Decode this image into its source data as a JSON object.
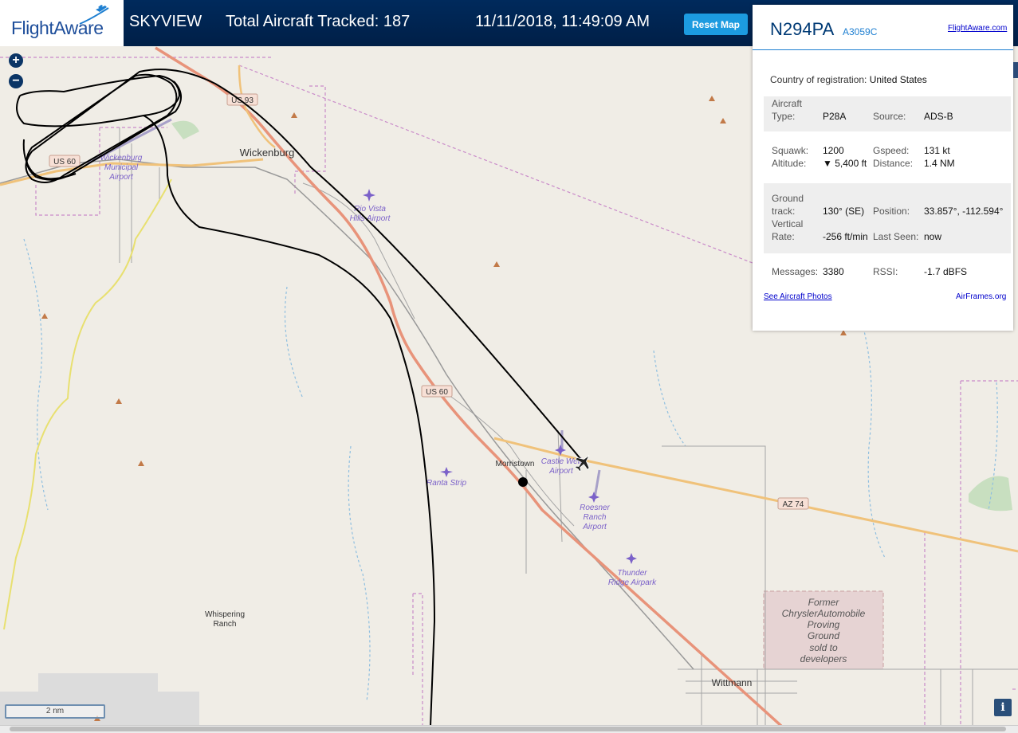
{
  "header": {
    "brand": "FlightAware",
    "app_name": "SKYVIEW",
    "total_tracked": "Total Aircraft Tracked: 187",
    "datetime": "11/11/2018, 11:49:09 AM",
    "reset_label": "Reset Map"
  },
  "map": {
    "zoom_in": "+",
    "zoom_out": "−",
    "scale_label": "2 nm",
    "info_label": "i",
    "labels": {
      "us93": "US 93",
      "us60_west": "US 60",
      "us60_mid": "US 60",
      "az74": "AZ 74",
      "wickenburg": "Wickenburg",
      "wick_airport": [
        "Wickenburg",
        "Municipal",
        "Airport"
      ],
      "rio_vista": [
        "Rio Vista",
        "Hills Airport"
      ],
      "castle_well": [
        "Castle Well",
        "Airport"
      ],
      "morristown": "Morristown",
      "ranta": "Ranta Strip",
      "roesner": [
        "Roesner",
        "Ranch",
        "Airport"
      ],
      "thunder": [
        "Thunder",
        "Ridge Airpark"
      ],
      "whispering": [
        "Whispering",
        "Ranch"
      ],
      "former": [
        "Former",
        "ChryslerAutomobile",
        "Proving",
        "Ground",
        "sold to",
        "developers"
      ],
      "wittmann": "Wittmann"
    }
  },
  "panel": {
    "ident": "N294PA",
    "hex": "A3059C",
    "fa_link": "FlightAware.com",
    "country_label": "Country of registration:",
    "country_value": "United States",
    "aircraft_type_label": "Aircraft\nType:",
    "aircraft_type": "P28A",
    "source_label": "Source:",
    "source": "ADS-B",
    "squawk_label": "Squawk:",
    "squawk": "1200",
    "gspeed_label": "Gspeed:",
    "gspeed": "131 kt",
    "altitude_label": "Altitude:",
    "altitude": "▼ 5,400 ft",
    "distance_label": "Distance:",
    "distance": "1.4 NM",
    "ground_track_label": "Ground\ntrack:",
    "ground_track": "130° (SE)",
    "position_label": "Position:",
    "position": "33.857°, -112.594°",
    "vrate_label": "Vertical\nRate:",
    "vrate": "-256 ft/min",
    "last_seen_label": "Last Seen:",
    "last_seen": "now",
    "messages_label": "Messages:",
    "messages": "3380",
    "rssi_label": "RSSI:",
    "rssi": "-1.7 dBFS",
    "photos_link": "See Aircraft Photos",
    "airframes_link": "AirFrames.org"
  },
  "colors": {
    "header_bg": "#002a5c",
    "reset_button": "#1c9be0",
    "highway": "#e8937a",
    "state_route": "#f0c27a",
    "track": "#000000",
    "airport": "#7b61c9"
  }
}
